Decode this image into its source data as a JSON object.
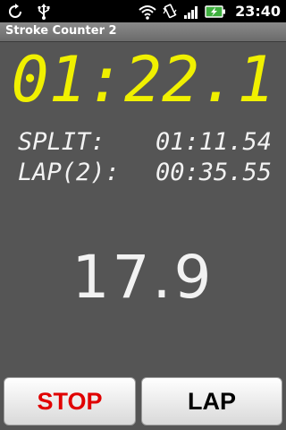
{
  "status_bar": {
    "time": "23:40",
    "icons_left": [
      "sync-icon",
      "usb-icon"
    ],
    "icons_right": [
      "wifi-icon",
      "vibrate-icon",
      "signal-icon",
      "battery-charging-icon"
    ]
  },
  "app": {
    "title": "Stroke Counter 2"
  },
  "timer": {
    "elapsed": "01:22.1",
    "color": "#f0f000"
  },
  "split": {
    "label": "SPLIT:",
    "value": "01:11.54"
  },
  "lap": {
    "label": "LAP(2):",
    "value": "00:35.55"
  },
  "stroke_rate": {
    "value": "17.9"
  },
  "buttons": {
    "stop_label": "STOP",
    "stop_color": "#e00000",
    "lap_label": "LAP"
  }
}
